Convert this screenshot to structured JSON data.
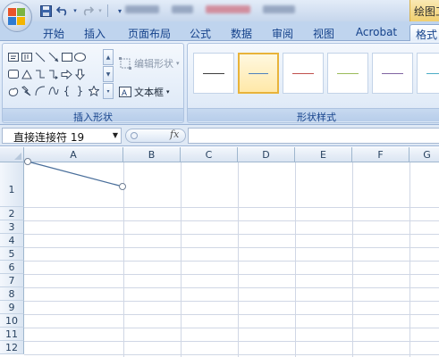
{
  "title_bar": {
    "drawing_tools_label": "绘图工具"
  },
  "quick_access": [
    "save-icon",
    "undo-icon",
    "redo-icon",
    "customize-icon"
  ],
  "ribbon_tabs": [
    "开始",
    "插入",
    "页面布局",
    "公式",
    "数据",
    "审阅",
    "视图",
    "Acrobat",
    "格式"
  ],
  "active_tab": "格式",
  "insert_shapes_group": {
    "label": "插入形状",
    "edit_shape_label": "编辑形状",
    "textbox_label": "文本框"
  },
  "shape_styles_group": {
    "label": "形状样式",
    "line_colors": [
      "#3f3f3f",
      "#4f81bd",
      "#c0504d",
      "#9bbb59",
      "#8064a2",
      "#4bacc6"
    ],
    "selected_index": 1
  },
  "formula_bar": {
    "name_box": "直接连接符 19",
    "fx_label": "fx",
    "formula": ""
  },
  "sheet": {
    "columns": [
      "A",
      "B",
      "C",
      "D",
      "E",
      "F",
      "G"
    ],
    "rows": [
      "1",
      "2",
      "3",
      "4",
      "5",
      "6",
      "7",
      "8",
      "9",
      "10",
      "11",
      "12"
    ]
  },
  "colors": {
    "ribbon_bg": "#dbe7f6",
    "tab_text": "#15428b",
    "connector_line": "#4a6f9b"
  }
}
